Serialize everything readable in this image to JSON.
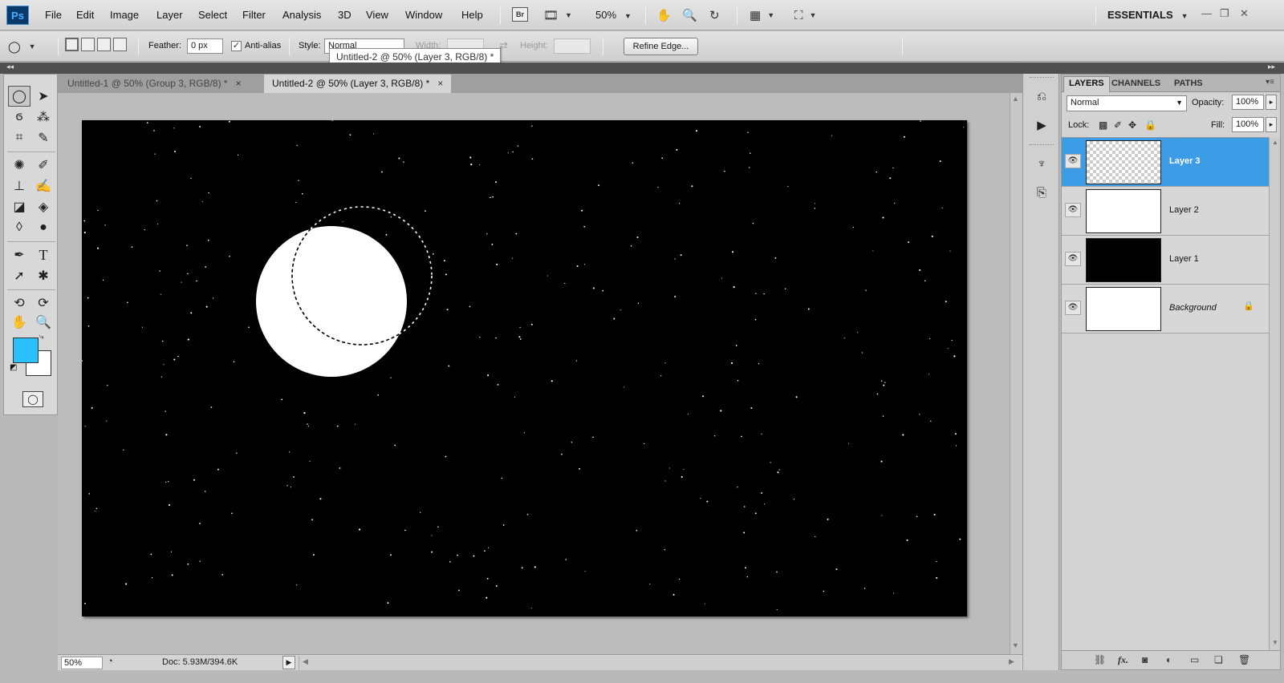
{
  "app": {
    "logo": "Ps",
    "workspace": "ESSENTIALS",
    "zoom_select": "50%",
    "bridge_label": "Br"
  },
  "menu": [
    "File",
    "Edit",
    "Image",
    "Layer",
    "Select",
    "Filter",
    "Analysis",
    "3D",
    "View",
    "Window",
    "Help"
  ],
  "options": {
    "feather_label": "Feather:",
    "feather_value": "0 px",
    "antialias_label": "Anti-alias",
    "antialias_checked": "✓",
    "style_label": "Style:",
    "style_value": "Normal",
    "width_label": "Width:",
    "height_label": "Height:",
    "refine_edge": "Refine Edge..."
  },
  "tooltip": "Untitled-2 @ 50% (Layer 3, RGB/8) *",
  "tabs": [
    {
      "label": "Untitled-1 @ 50% (Group 3, RGB/8) *",
      "close": "×"
    },
    {
      "label": "Untitled-2 @ 50% (Layer 3, RGB/8) *",
      "close": "×"
    }
  ],
  "colors": {
    "foreground": "#29c2ff",
    "background": "#ffffff",
    "selected_layer": "#3d9ce6"
  },
  "status": {
    "zoom": "50%",
    "doc": "Doc: 5.93M/394.6K"
  },
  "layers_panel": {
    "tabs": [
      "LAYERS",
      "CHANNELS",
      "PATHS"
    ],
    "blend_mode": "Normal",
    "opacity_label": "Opacity:",
    "opacity_value": "100%",
    "lock_label": "Lock:",
    "fill_label": "Fill:",
    "fill_value": "100%",
    "layers": [
      {
        "name": "Layer 3",
        "selected": true
      },
      {
        "name": "Layer 2"
      },
      {
        "name": "Layer 1"
      },
      {
        "name": "Background",
        "locked": true
      }
    ]
  }
}
